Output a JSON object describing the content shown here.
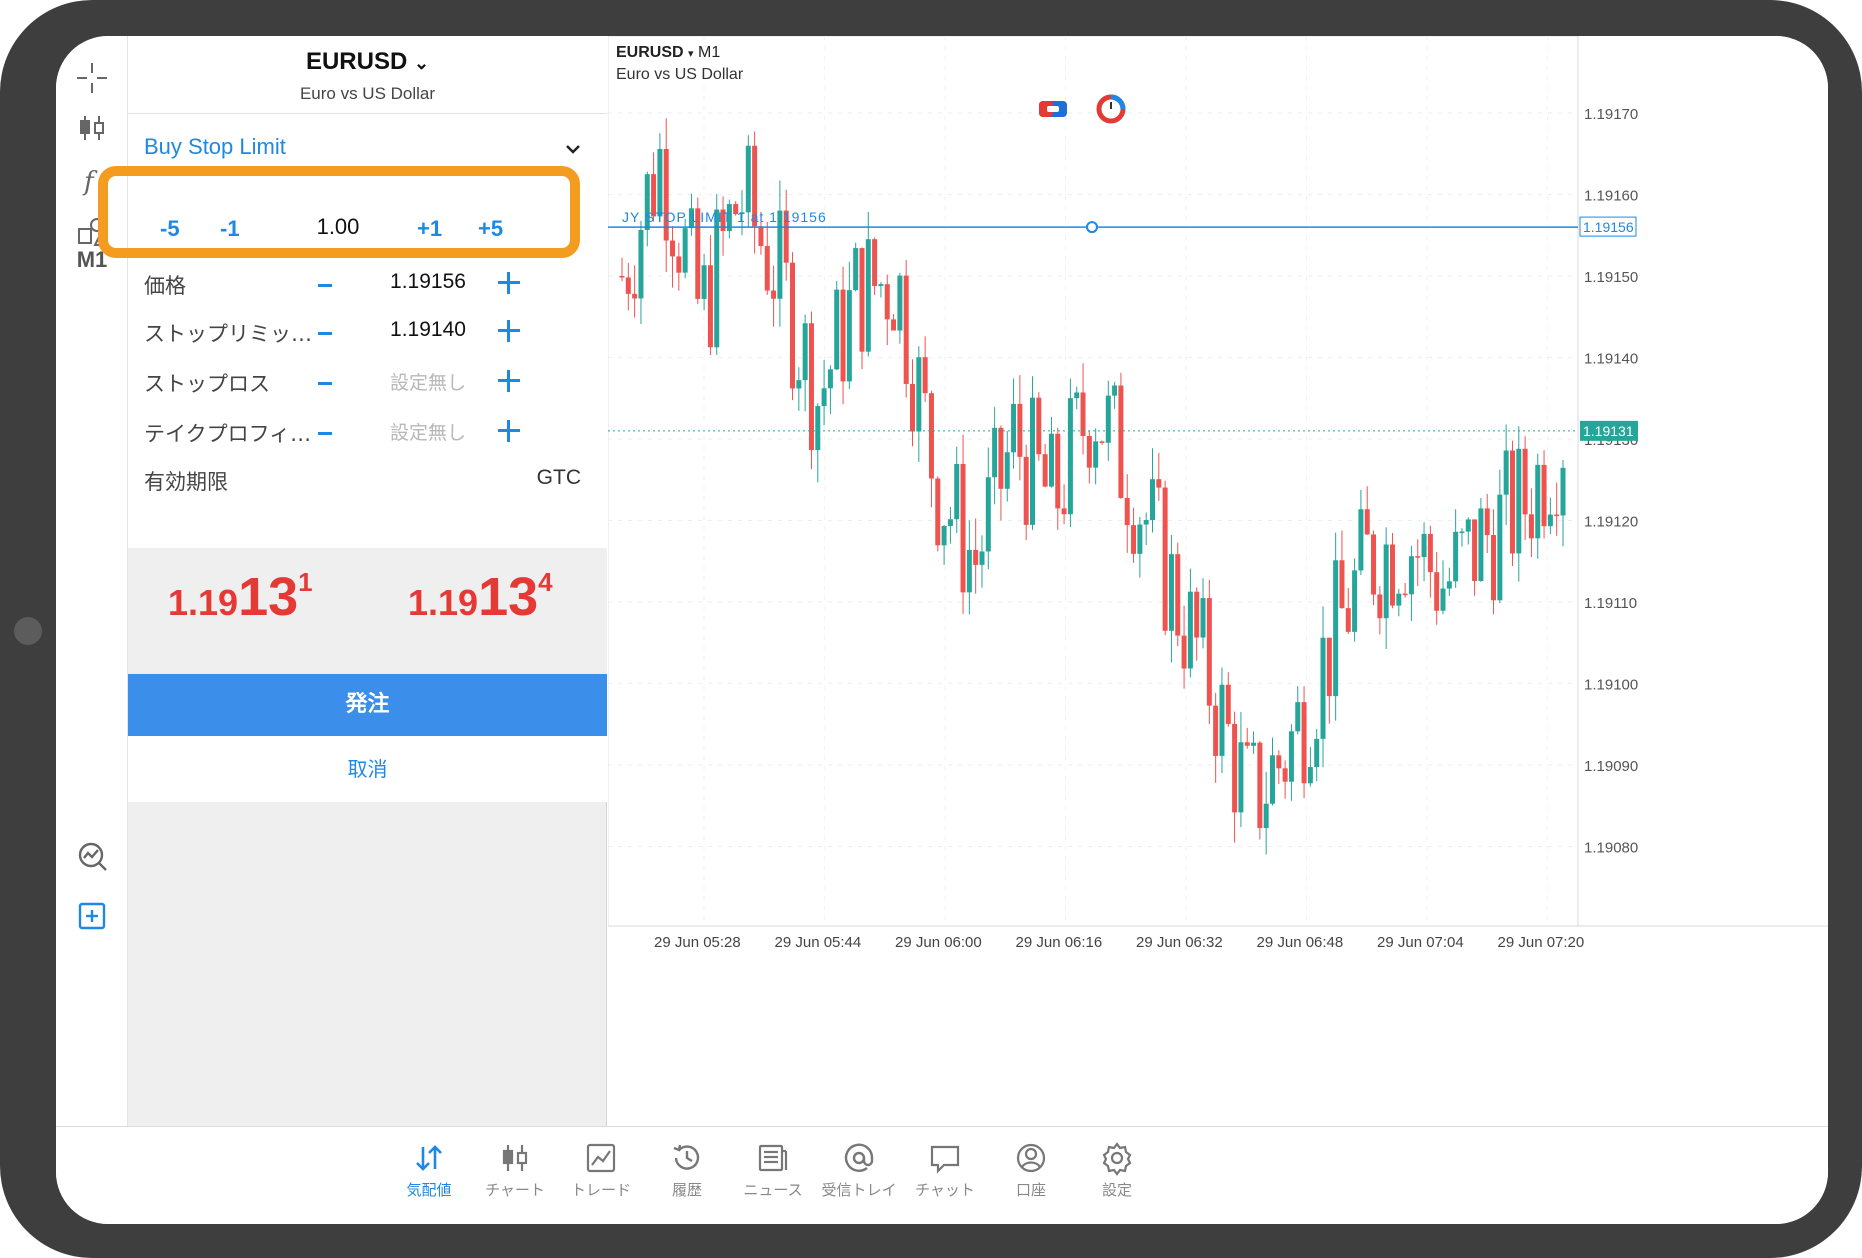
{
  "toolbar": {
    "timeframe": "M1",
    "icons": [
      "crosshair-icon",
      "chart-type-icon",
      "indicators-icon",
      "objects-icon",
      "signals-icon",
      "new-order-icon"
    ]
  },
  "order": {
    "symbol": "EURUSD",
    "description": "Euro vs US Dollar",
    "type": "Buy Stop Limit",
    "volume": {
      "minus5": "-5",
      "minus1": "-1",
      "value": "1.00",
      "plus1": "+1",
      "plus5": "+5"
    },
    "fields": [
      {
        "label": "価格",
        "value": "1.19156",
        "muted": false
      },
      {
        "label": "ストップリミッ…",
        "value": "1.19140",
        "muted": false
      },
      {
        "label": "ストップロス",
        "value": "設定無し",
        "muted": true
      },
      {
        "label": "テイクプロフィ…",
        "value": "設定無し",
        "muted": true
      }
    ],
    "expiry": {
      "label": "有効期限",
      "value": "GTC"
    },
    "bid": {
      "small": "1.19",
      "big": "13",
      "sup": "1"
    },
    "ask": {
      "small": "1.19",
      "big": "13",
      "sup": "4"
    },
    "submit_label": "発注",
    "cancel_label": "取消"
  },
  "chart": {
    "symbol": "EURUSD",
    "timeframe": "M1",
    "description": "Euro vs US Dollar",
    "order_line_label": "JY STOP LIMIT 1 at 1.19156",
    "order_line_price": "1.19156",
    "current_price": "1.19131",
    "price_ticks": [
      "1.19170",
      "1.19160",
      "1.19150",
      "1.19140",
      "1.19130",
      "1.19120",
      "1.19110",
      "1.19100",
      "1.19090",
      "1.19080"
    ],
    "time_ticks": [
      "29 Jun 05:28",
      "29 Jun 05:44",
      "29 Jun 06:00",
      "29 Jun 06:16",
      "29 Jun 06:32",
      "29 Jun 06:48",
      "29 Jun 07:04",
      "29 Jun 07:20"
    ],
    "colors": {
      "bull": "#26a69a",
      "bear": "#ef5350",
      "order_line": "#1e88e5",
      "current_line": "#26a69a",
      "highlight": "#f39c1f"
    }
  },
  "chart_data": {
    "type": "candlestick",
    "x": [
      "05:28",
      "05:44",
      "06:00",
      "06:16",
      "06:32",
      "06:48",
      "07:04",
      "07:20"
    ],
    "ylim": [
      1.19075,
      1.19175
    ],
    "close_series": [
      1.1915,
      1.19165,
      1.19145,
      1.1916,
      1.1915,
      1.19135,
      1.19148,
      1.1915,
      1.19125,
      1.19115,
      1.1913,
      1.19122,
      1.19135,
      1.19125,
      1.19112,
      1.191,
      1.19085,
      1.19092,
      1.19104,
      1.19115,
      1.19118,
      1.19112,
      1.19118,
      1.19122,
      1.19131
    ]
  },
  "bottom_nav": [
    {
      "label": "気配値",
      "icon": "quotes-icon",
      "active": true
    },
    {
      "label": "チャート",
      "icon": "chart-icon",
      "active": false
    },
    {
      "label": "トレード",
      "icon": "trade-icon",
      "active": false
    },
    {
      "label": "履歴",
      "icon": "history-icon",
      "active": false
    },
    {
      "label": "ニュース",
      "icon": "news-icon",
      "active": false
    },
    {
      "label": "受信トレイ",
      "icon": "mailbox-icon",
      "active": false
    },
    {
      "label": "チャット",
      "icon": "chat-icon",
      "active": false
    },
    {
      "label": "口座",
      "icon": "account-icon",
      "active": false
    },
    {
      "label": "設定",
      "icon": "settings-icon",
      "active": false
    }
  ]
}
